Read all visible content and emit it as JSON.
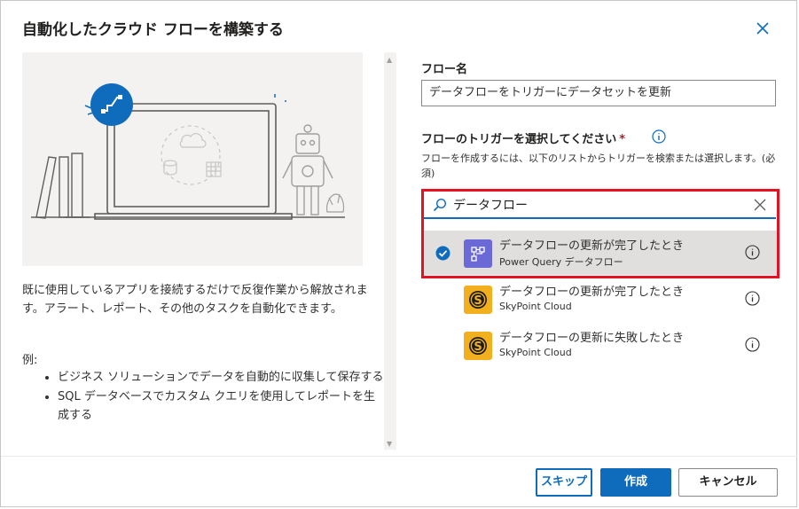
{
  "dialog": {
    "title": "自動化したクラウド フローを構築する",
    "close_icon": "close-icon"
  },
  "left": {
    "description": "既に使用しているアプリを接続するだけで反復作業から解放されます。アラート、レポート、その他のタスクを自動化できます。",
    "example_label": "例:",
    "examples": [
      "ビジネス ソリューションでデータを自動的に収集して保存する",
      "SQL データベースでカスタム クエリを使用してレポートを生成する"
    ]
  },
  "form": {
    "flow_name_label": "フロー名",
    "flow_name_value": "データフローをトリガーにデータセットを更新",
    "trigger_label": "フローのトリガーを選択してください",
    "required_mark": "*",
    "trigger_help": "フローを作成するには、以下のリストからトリガーを検索または選択します。(必須)",
    "search_value": "データフロー"
  },
  "triggers": [
    {
      "name": "データフローの更新が完了したとき",
      "connector": "Power Query データフロー",
      "selected": true,
      "icon": "power-query-dataflow-icon",
      "color": "#6b69d6"
    },
    {
      "name": "データフローの更新が完了したとき",
      "connector": "SkyPoint Cloud",
      "selected": false,
      "icon": "skypoint-icon",
      "color": "#f2b01e"
    },
    {
      "name": "データフローの更新に失敗したとき",
      "connector": "SkyPoint Cloud",
      "selected": false,
      "icon": "skypoint-icon",
      "color": "#f2b01e"
    }
  ],
  "buttons": {
    "skip": "スキップ",
    "create": "作成",
    "cancel": "キャンセル"
  },
  "colors": {
    "accent": "#0f6cbd",
    "highlight_box": "#e81123",
    "selected_row": "#e1dfdd"
  }
}
